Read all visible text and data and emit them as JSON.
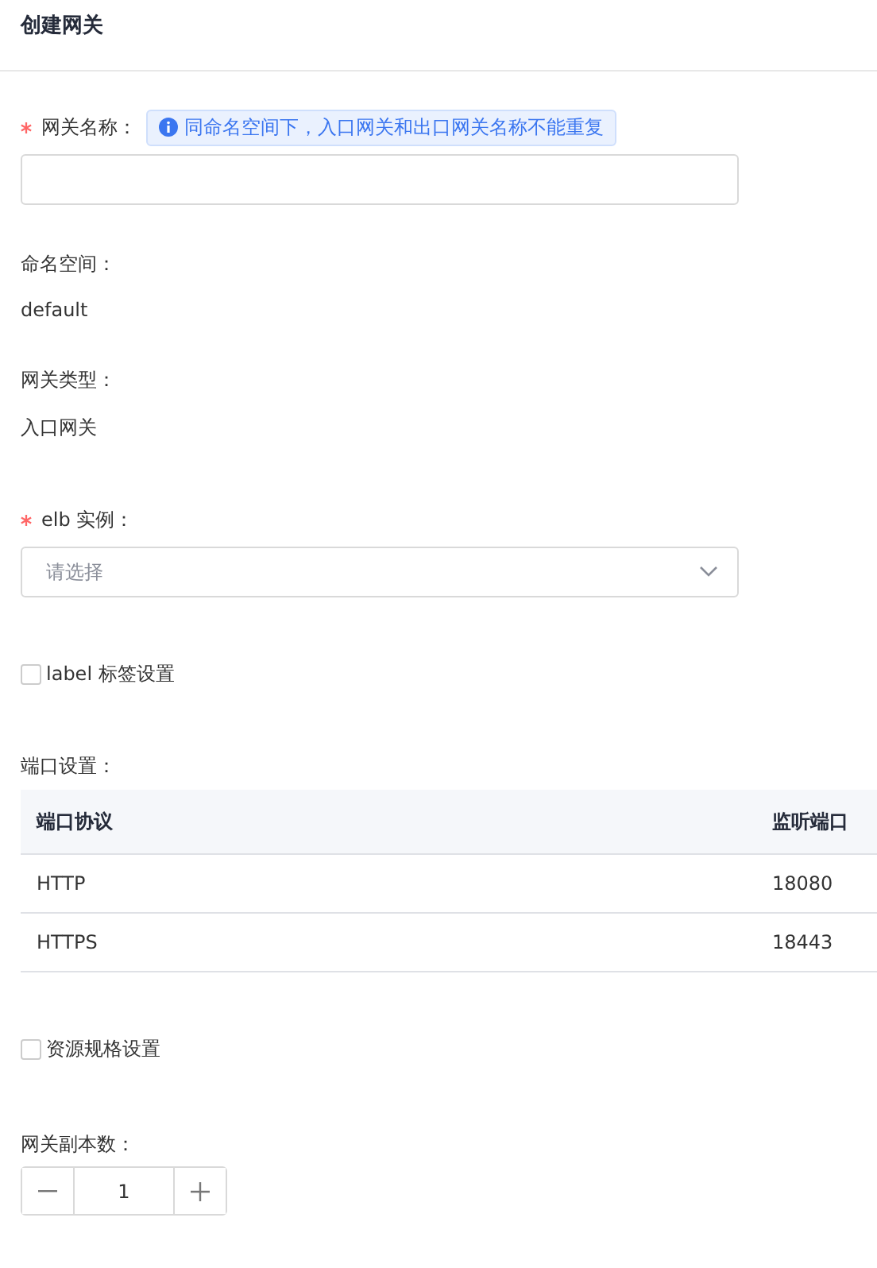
{
  "title": "创建网关",
  "fields": [
    {
      "kind": "text-input",
      "label": "网关名称：",
      "required": true,
      "hint": "同命名空间下，入口网关和出口网关名称不能重复"
    },
    {
      "kind": "static",
      "label": "命名空间：",
      "value": "default"
    },
    {
      "kind": "static",
      "label": "网关类型：",
      "value": "入口网关"
    },
    {
      "kind": "select",
      "label": "elb 实例：",
      "required": true,
      "placeholder": "请选择"
    },
    {
      "kind": "checkbox",
      "label": "label 标签设置",
      "checked": false
    },
    {
      "kind": "table",
      "label": "端口设置：",
      "columns": [
        "端口协议",
        "监听端口"
      ],
      "rows": [
        [
          "HTTP",
          "18080"
        ],
        [
          "HTTPS",
          "18443"
        ]
      ]
    },
    {
      "kind": "checkbox",
      "label": "资源规格设置",
      "checked": false
    },
    {
      "kind": "stepper",
      "label": "网关副本数：",
      "value": "1"
    }
  ]
}
